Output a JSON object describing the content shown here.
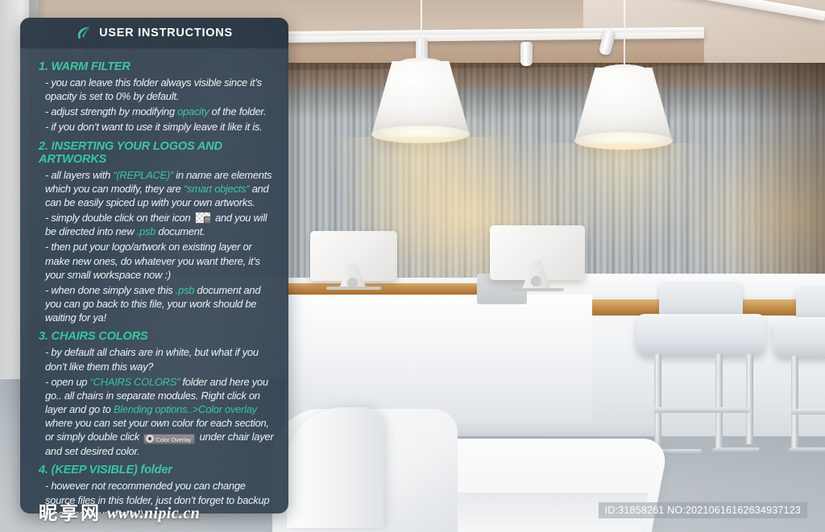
{
  "panel": {
    "icon": "leaf-icon",
    "title": "USER INSTRUCTIONS",
    "accent_color": "#2fc79c",
    "background_color": "#2f3e4e",
    "sections": [
      {
        "heading": "1. WARM FILTER",
        "lines": [
          {
            "parts": [
              {
                "t": "- you can leave this folder always visible since it’s opacity is set to 0% by default."
              }
            ]
          },
          {
            "parts": [
              {
                "t": "- adjust strength by modifying "
              },
              {
                "t": "opacity",
                "hl": true
              },
              {
                "t": " of the folder."
              }
            ]
          },
          {
            "parts": [
              {
                "t": "- if you don’t want to use it simply leave it like it is."
              }
            ]
          }
        ]
      },
      {
        "heading": "2. INSERTING YOUR LOGOS AND ARTWORKS",
        "lines": [
          {
            "parts": [
              {
                "t": "- all layers with "
              },
              {
                "t": "“(REPLACE)”",
                "hl": true
              },
              {
                "t": " in name are elements which you can modify, they are "
              },
              {
                "t": "“smart objects“",
                "hl": true
              },
              {
                "t": " and can be easily spiced up with your own artworks."
              }
            ]
          },
          {
            "parts": [
              {
                "t": "- simply double click on their icon "
              },
              {
                "icon": "smart-object-icon"
              },
              {
                "t": " and you will be directed into new "
              },
              {
                "t": ".psb",
                "hl": true
              },
              {
                "t": " document."
              }
            ]
          },
          {
            "parts": [
              {
                "t": "- then put your logo/artwork on existing layer or make new ones, do whatever you want there, it’s your small workspace now :)"
              }
            ]
          },
          {
            "parts": [
              {
                "t": "- when done simply save this "
              },
              {
                "t": ".psb",
                "hl": true
              },
              {
                "t": " document and you can go back to this file, your work should be waiting for ya!"
              }
            ]
          }
        ]
      },
      {
        "heading": "3. CHAIRS COLORS",
        "lines": [
          {
            "parts": [
              {
                "t": "- by default all chairs are in white, but what if you don’t like them this way?"
              }
            ]
          },
          {
            "parts": [
              {
                "t": "- open up "
              },
              {
                "t": "“CHAIRS COLORS”",
                "hl": true
              },
              {
                "t": " folder and here you go.. all chairs in separate modules. Right click on layer and go to "
              },
              {
                "t": "Blending options..>Color overlay",
                "hl": true
              },
              {
                "t": " where you can set your own color for each section, or simply double click "
              },
              {
                "chip": "Color Overlay"
              },
              {
                "t": " under chair layer and set desired color."
              }
            ]
          }
        ]
      },
      {
        "heading": "4. (KEEP VISIBLE) folder",
        "lines": [
          {
            "parts": [
              {
                "t": "- however not recommended you can change source files in this folder, just don’t forget to backup what you have done ;)"
              }
            ]
          }
        ]
      }
    ]
  },
  "watermark": {
    "brand_chars": [
      "昵",
      "享",
      "网"
    ],
    "url": "www.nipic.cn",
    "id_text": "ID:31858261 NO:20210616162634937123"
  },
  "scene": {
    "description": "office-reception-interior",
    "wood_wall_color": "#c08a4c",
    "floor_color": "#a8b0b6",
    "counter_wood_color": "#c08946",
    "objects": [
      {
        "name": "pendant-lamp",
        "count": 2
      },
      {
        "name": "track-spotlight",
        "count": 4
      },
      {
        "name": "desktop-monitor",
        "count": 2
      },
      {
        "name": "bar-stool",
        "count": 2
      },
      {
        "name": "sofa",
        "count": 1
      },
      {
        "name": "rug",
        "count": 1
      }
    ]
  }
}
